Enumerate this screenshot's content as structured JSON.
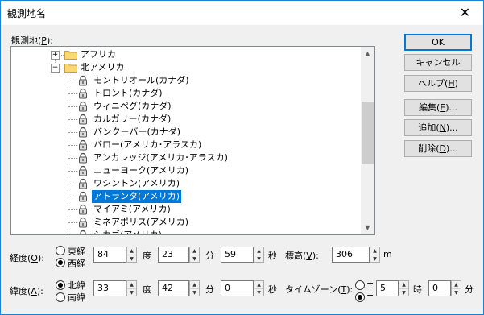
{
  "window": {
    "title": "観測地名",
    "close_glyph": "✕"
  },
  "location_label": {
    "text": "観測地(",
    "key": "P",
    "end": "):"
  },
  "tree": {
    "items": [
      {
        "label": "アフリカ",
        "kind": "folder",
        "expander": "+"
      },
      {
        "label": "北アメリカ",
        "kind": "folder",
        "expander": "−"
      },
      {
        "label": "モントリオール(カナダ)",
        "kind": "city"
      },
      {
        "label": "トロント(カナダ)",
        "kind": "city"
      },
      {
        "label": "ウィニペグ(カナダ)",
        "kind": "city"
      },
      {
        "label": "カルガリー(カナダ)",
        "kind": "city"
      },
      {
        "label": "バンクーバー(カナダ)",
        "kind": "city"
      },
      {
        "label": "バロー(アメリカ･アラスカ)",
        "kind": "city"
      },
      {
        "label": "アンカレッジ(アメリカ･アラスカ)",
        "kind": "city"
      },
      {
        "label": "ニューヨーク(アメリカ)",
        "kind": "city"
      },
      {
        "label": "ワシントン(アメリカ)",
        "kind": "city"
      },
      {
        "label": "アトランタ(アメリカ)",
        "kind": "city",
        "selected": true
      },
      {
        "label": "マイアミ(アメリカ)",
        "kind": "city"
      },
      {
        "label": "ミネアポリス(アメリカ)",
        "kind": "city"
      },
      {
        "label": "シカゴ(アメリカ)",
        "kind": "city"
      }
    ]
  },
  "buttons": {
    "ok": {
      "text": "OK"
    },
    "cancel": {
      "text": "キャンセル"
    },
    "help": {
      "text": "ヘルプ(",
      "key": "H",
      "end": ")"
    },
    "edit": {
      "text": "編集(",
      "key": "E",
      "end": ")..."
    },
    "add": {
      "text": "追加(",
      "key": "N",
      "end": ")..."
    },
    "delete": {
      "text": "削除(",
      "key": "D",
      "end": ")..."
    }
  },
  "longitude": {
    "label": "経度(",
    "key": "O",
    "end": "):",
    "options": [
      "東経",
      "西経"
    ],
    "selected": "西経",
    "deg": "84",
    "deg_unit": "度",
    "min": "23",
    "min_unit": "分",
    "sec": "59",
    "sec_unit": "秒"
  },
  "altitude": {
    "label": "標高(",
    "key": "V",
    "end": "):",
    "value": "306",
    "unit": "m"
  },
  "latitude": {
    "label": "緯度(",
    "key": "A",
    "end": "):",
    "options": [
      "北緯",
      "南緯"
    ],
    "selected": "北緯",
    "deg": "33",
    "deg_unit": "度",
    "min": "42",
    "min_unit": "分",
    "sec": "0",
    "sec_unit": "秒"
  },
  "timezone": {
    "label": "タイムゾーン(",
    "key": "T",
    "end": "):",
    "options": [
      "+",
      "−"
    ],
    "selected": "−",
    "hours": "5",
    "hours_unit": "時",
    "minutes": "0",
    "minutes_unit": "分"
  }
}
